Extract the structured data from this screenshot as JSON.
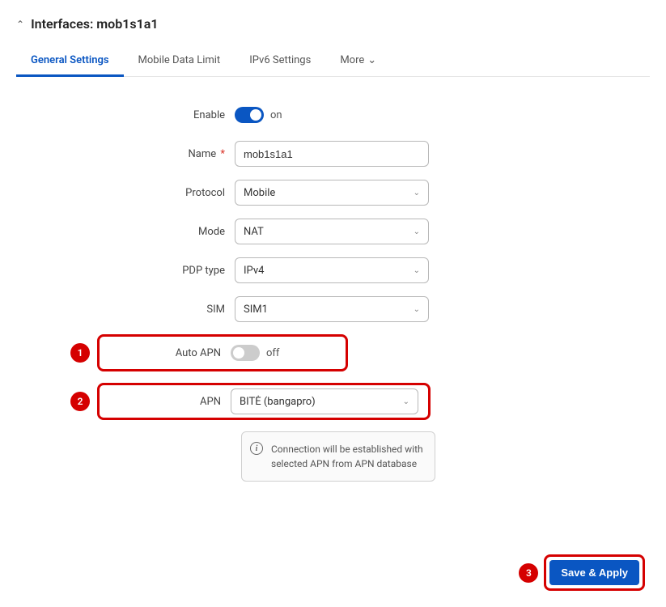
{
  "header": {
    "title": "Interfaces: mob1s1a1"
  },
  "tabs": {
    "items": [
      {
        "label": "General Settings"
      },
      {
        "label": "Mobile Data Limit"
      },
      {
        "label": "IPv6 Settings"
      },
      {
        "label": "More"
      }
    ]
  },
  "form": {
    "enable": {
      "label": "Enable",
      "state": "on"
    },
    "name": {
      "label": "Name",
      "value": "mob1s1a1",
      "required": "*"
    },
    "protocol": {
      "label": "Protocol",
      "value": "Mobile"
    },
    "mode": {
      "label": "Mode",
      "value": "NAT"
    },
    "pdp": {
      "label": "PDP type",
      "value": "IPv4"
    },
    "sim": {
      "label": "SIM",
      "value": "SIM1"
    },
    "autoapn": {
      "label": "Auto APN",
      "state": "off"
    },
    "apn": {
      "label": "APN",
      "value": "BITĖ (bangapro)"
    },
    "info": "Connection will be established with selected APN from APN database"
  },
  "annotations": {
    "n1": "1",
    "n2": "2",
    "n3": "3"
  },
  "footer": {
    "save": "Save & Apply"
  }
}
